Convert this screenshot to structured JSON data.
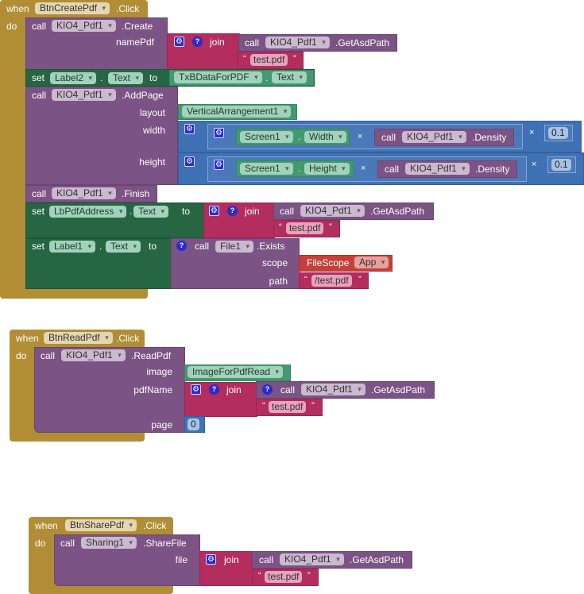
{
  "workspace": "blocks-editor",
  "kw": {
    "when": "when",
    "do": "do",
    "call": "call",
    "set": "set",
    "to": "to",
    "join": "join",
    "dot": ".",
    "times": "×",
    "lq": "“",
    "rq": "”"
  },
  "block1": {
    "component": "BtnCreatePdf",
    "event": ".Click",
    "create": {
      "component": "KIO4_Pdf1",
      "method": ".Create",
      "arg": "namePdf",
      "getpath": {
        "component": "KIO4_Pdf1",
        "method": ".GetAsdPath"
      },
      "text": "test.pdf"
    },
    "set1": {
      "component": "Label2",
      "prop": "Text",
      "value_component": "TxBDataForPDF",
      "value_prop": "Text"
    },
    "addpage": {
      "component": "KIO4_Pdf1",
      "method": ".AddPage",
      "args": [
        "layout",
        "width",
        "height"
      ],
      "layout_value": "VerticalArrangement1",
      "width": {
        "screen": "Screen1",
        "prop": "Width",
        "density_component": "KIO4_Pdf1",
        "density_method": ".Density",
        "factor": "0.1"
      },
      "height": {
        "screen": "Screen1",
        "prop": "Height",
        "density_component": "KIO4_Pdf1",
        "density_method": ".Density",
        "factor": "0.1"
      }
    },
    "finish": {
      "component": "KIO4_Pdf1",
      "method": ".Finish"
    },
    "set2": {
      "component": "LbPdfAddress",
      "prop": "Text",
      "getpath": {
        "component": "KIO4_Pdf1",
        "method": ".GetAsdPath"
      },
      "text": "test.pdf"
    },
    "set3": {
      "component": "Label1",
      "prop": "Text",
      "exists": {
        "component": "File1",
        "method": ".Exists",
        "args": [
          "scope",
          "path"
        ],
        "scope_label": "FileScope",
        "scope_value": "App",
        "path": "/test.pdf"
      }
    }
  },
  "block2": {
    "component": "BtnReadPdf",
    "event": ".Click",
    "read": {
      "component": "KIO4_Pdf1",
      "method": ".ReadPdf",
      "args": [
        "image",
        "pdfName",
        "page"
      ],
      "image_value": "ImageForPdfRead",
      "getpath": {
        "component": "KIO4_Pdf1",
        "method": ".GetAsdPath"
      },
      "text": "test.pdf",
      "page_value": "0"
    }
  },
  "block3": {
    "component": "BtnSharePdf",
    "event": ".Click",
    "share": {
      "component": "Sharing1",
      "method": ".ShareFile",
      "arg": "file",
      "getpath": {
        "component": "KIO4_Pdf1",
        "method": ".GetAsdPath"
      },
      "text": "test.pdf"
    }
  }
}
